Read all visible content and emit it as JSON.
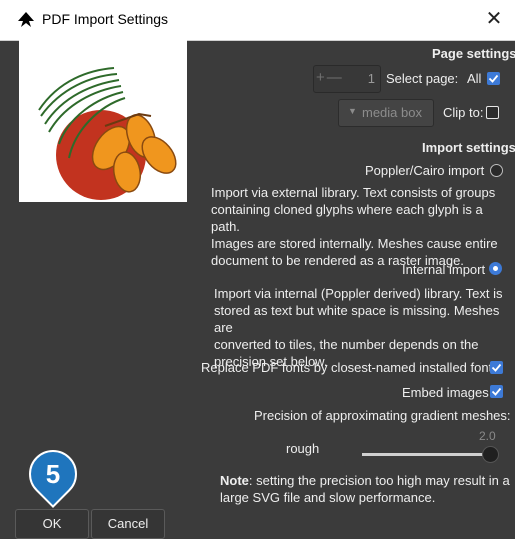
{
  "window": {
    "title": "PDF Import Settings",
    "close_glyph": "✕"
  },
  "page_settings": {
    "heading": "Page settings",
    "spin_minus": "+—",
    "spin_value": "1",
    "select_page_label": "Select page:",
    "all_label": "All",
    "all_checked": true,
    "box_option": "media box",
    "clip_to_label": "Clip to:",
    "clip_to_checked": false
  },
  "import_settings": {
    "heading": "Import settings",
    "poppler_label": "Poppler/Cairo import",
    "poppler_selected": false,
    "poppler_desc": [
      "Import via external library. Text consists of groups",
      "containing cloned glyphs where each glyph is a path.",
      "Images are stored internally. Meshes cause entire",
      "document to be rendered as a raster image."
    ],
    "internal_label": "Internal import",
    "internal_selected": true,
    "internal_desc": [
      "Import via internal (Poppler derived) library. Text is",
      "stored as text but white space is missing. Meshes are",
      "converted to tiles, the number depends on the",
      "precision set below."
    ],
    "replace_fonts_label": "Replace PDF fonts by closest-named installed fonts",
    "replace_fonts_checked": true,
    "embed_images_label": "Embed images",
    "embed_images_checked": true,
    "precision_label": "Precision of approximating gradient meshes:",
    "precision_level": "rough",
    "precision_value": "2.0",
    "note_bold": "Note",
    "note_rest_1": ": setting the precision too high may result in a",
    "note_rest_2": "large SVG file and slow performance."
  },
  "buttons": {
    "ok": "OK",
    "cancel": "Cancel"
  },
  "step_badge": "5",
  "icons": [
    "inkscape-logo-icon",
    "close-icon",
    "checkmark-icon",
    "dropdown-arrow-icon"
  ],
  "colors": {
    "accent": "#3d7ad7",
    "badge": "#1f75bd",
    "background": "#3b3b3b"
  }
}
